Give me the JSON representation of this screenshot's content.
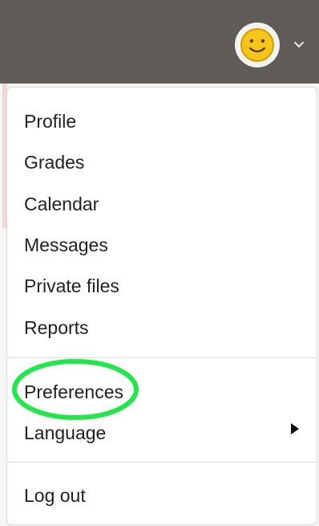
{
  "header": {
    "avatar_icon": "smiley-face-icon",
    "dropdown_icon": "chevron-down-icon"
  },
  "menu": {
    "items": [
      {
        "label": "Profile"
      },
      {
        "label": "Grades"
      },
      {
        "label": "Calendar"
      },
      {
        "label": "Messages"
      },
      {
        "label": "Private files"
      },
      {
        "label": "Reports"
      },
      {
        "label": "Preferences"
      },
      {
        "label": "Language"
      },
      {
        "label": "Log out"
      }
    ],
    "language_submenu_icon": "caret-right-icon"
  },
  "annotation": {
    "color": "#22e64a",
    "target": "Preferences"
  },
  "colors": {
    "topbar": "#5f5b57",
    "menu_bg": "#ffffff",
    "text": "#1d2125",
    "avatar_face": "#f5c51b"
  }
}
